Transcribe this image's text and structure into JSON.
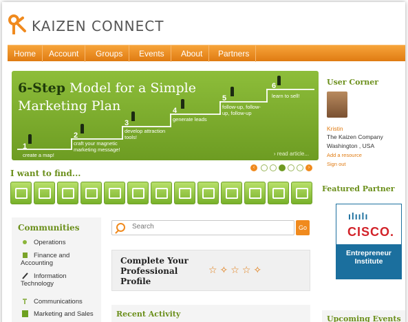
{
  "brand": {
    "name": "KAIZEN CONNECT",
    "accent": "#f08a1e",
    "green": "#6b8f1b"
  },
  "nav": {
    "items": [
      "Home",
      "Account",
      "Groups",
      "Events",
      "About",
      "Partners"
    ]
  },
  "hero": {
    "title_prefix": "6-Step",
    "title_rest": " Model for a Simple",
    "title_line2": "Marketing Plan",
    "steps": [
      {
        "num": "1",
        "label": "create a map!"
      },
      {
        "num": "2",
        "label": "craft your magnetic marketing message!"
      },
      {
        "num": "3",
        "label": "develop attraction tools!"
      },
      {
        "num": "4",
        "label": "generate leads"
      },
      {
        "num": "5",
        "label": "follow-up, follow-up, follow-up"
      },
      {
        "num": "6",
        "label": "learn to sell!"
      }
    ],
    "read_more": "› read article..."
  },
  "carousel": {
    "prev": "‹",
    "next": "›"
  },
  "find": {
    "title": "I want to find..."
  },
  "communities": {
    "title": "Communities",
    "items": [
      "Operations",
      "Finance and Accounting",
      "Information Technology",
      "Communications",
      "Marketing and Sales"
    ]
  },
  "search": {
    "placeholder": "Search",
    "go_label": "Go"
  },
  "profile": {
    "text": "Complete Your Professional Profile"
  },
  "recent": {
    "title": "Recent Activity"
  },
  "user_corner": {
    "title": "User Corner",
    "name": "Kristin",
    "company": "The Kaizen Company",
    "location": "Washington , USA",
    "add_resource": "Add a resource",
    "sign_out": "Sign out"
  },
  "featured_partner": {
    "title": "Featured Partner",
    "logo_text": "CISCO.",
    "logo_bars": "ılıılı",
    "subtitle": "Entrepreneur Institute"
  },
  "events": {
    "title": "Upcoming Events"
  }
}
